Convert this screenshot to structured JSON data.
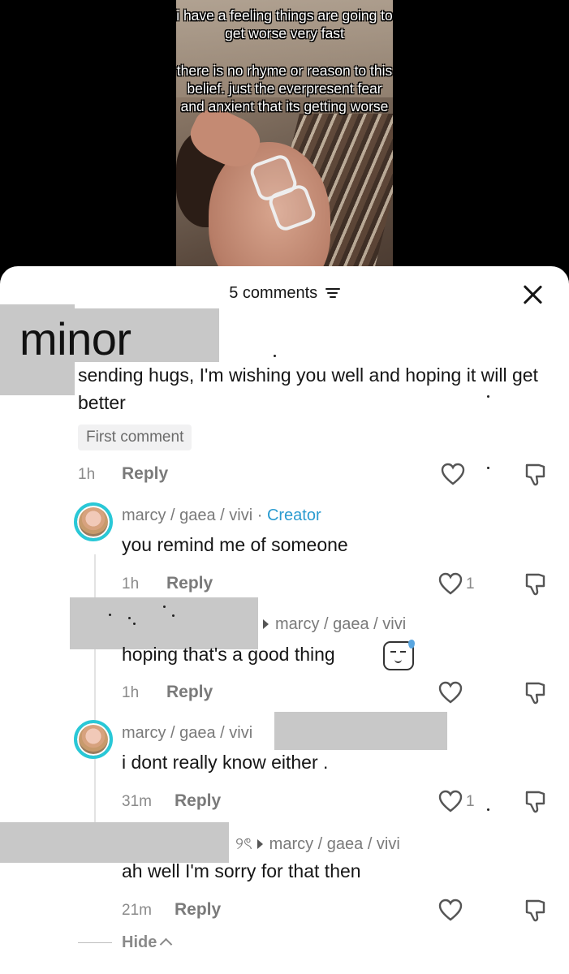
{
  "video": {
    "caption_line1": "i have a feeling things are going to get worse very fast",
    "caption_line2": "there is no rhyme or reason to this belief. just the everpresent fear and anxient that its getting worse"
  },
  "header": {
    "title": "5 comments"
  },
  "redaction_label": "minor",
  "comments": [
    {
      "text": "sending hugs, I'm wishing you well and hoping it will get better",
      "badge": "First comment",
      "time": "1h",
      "reply": "Reply"
    },
    {
      "author": "marcy / gaea / vivi",
      "sep": " · ",
      "role": "Creator",
      "text": "you remind me of someone",
      "time": "1h",
      "reply": "Reply",
      "likes": "1"
    },
    {
      "reply_to": "marcy / gaea / vivi",
      "text": "hoping that's a good thing",
      "time": "1h",
      "reply": "Reply"
    },
    {
      "author": "marcy / gaea / vivi",
      "text": "i dont really know either .",
      "time": "31m",
      "reply": "Reply",
      "likes": "1"
    },
    {
      "name_suffix": "୨ৎ",
      "reply_to": "marcy / gaea / vivi",
      "text": "ah well I'm sorry for that then",
      "time": "21m",
      "reply": "Reply"
    }
  ],
  "footer": {
    "hide": "Hide"
  },
  "colors": {
    "accent_ring": "#29c8d7",
    "creator": "#2a9bd0",
    "redaction": "#c8c8c8"
  }
}
